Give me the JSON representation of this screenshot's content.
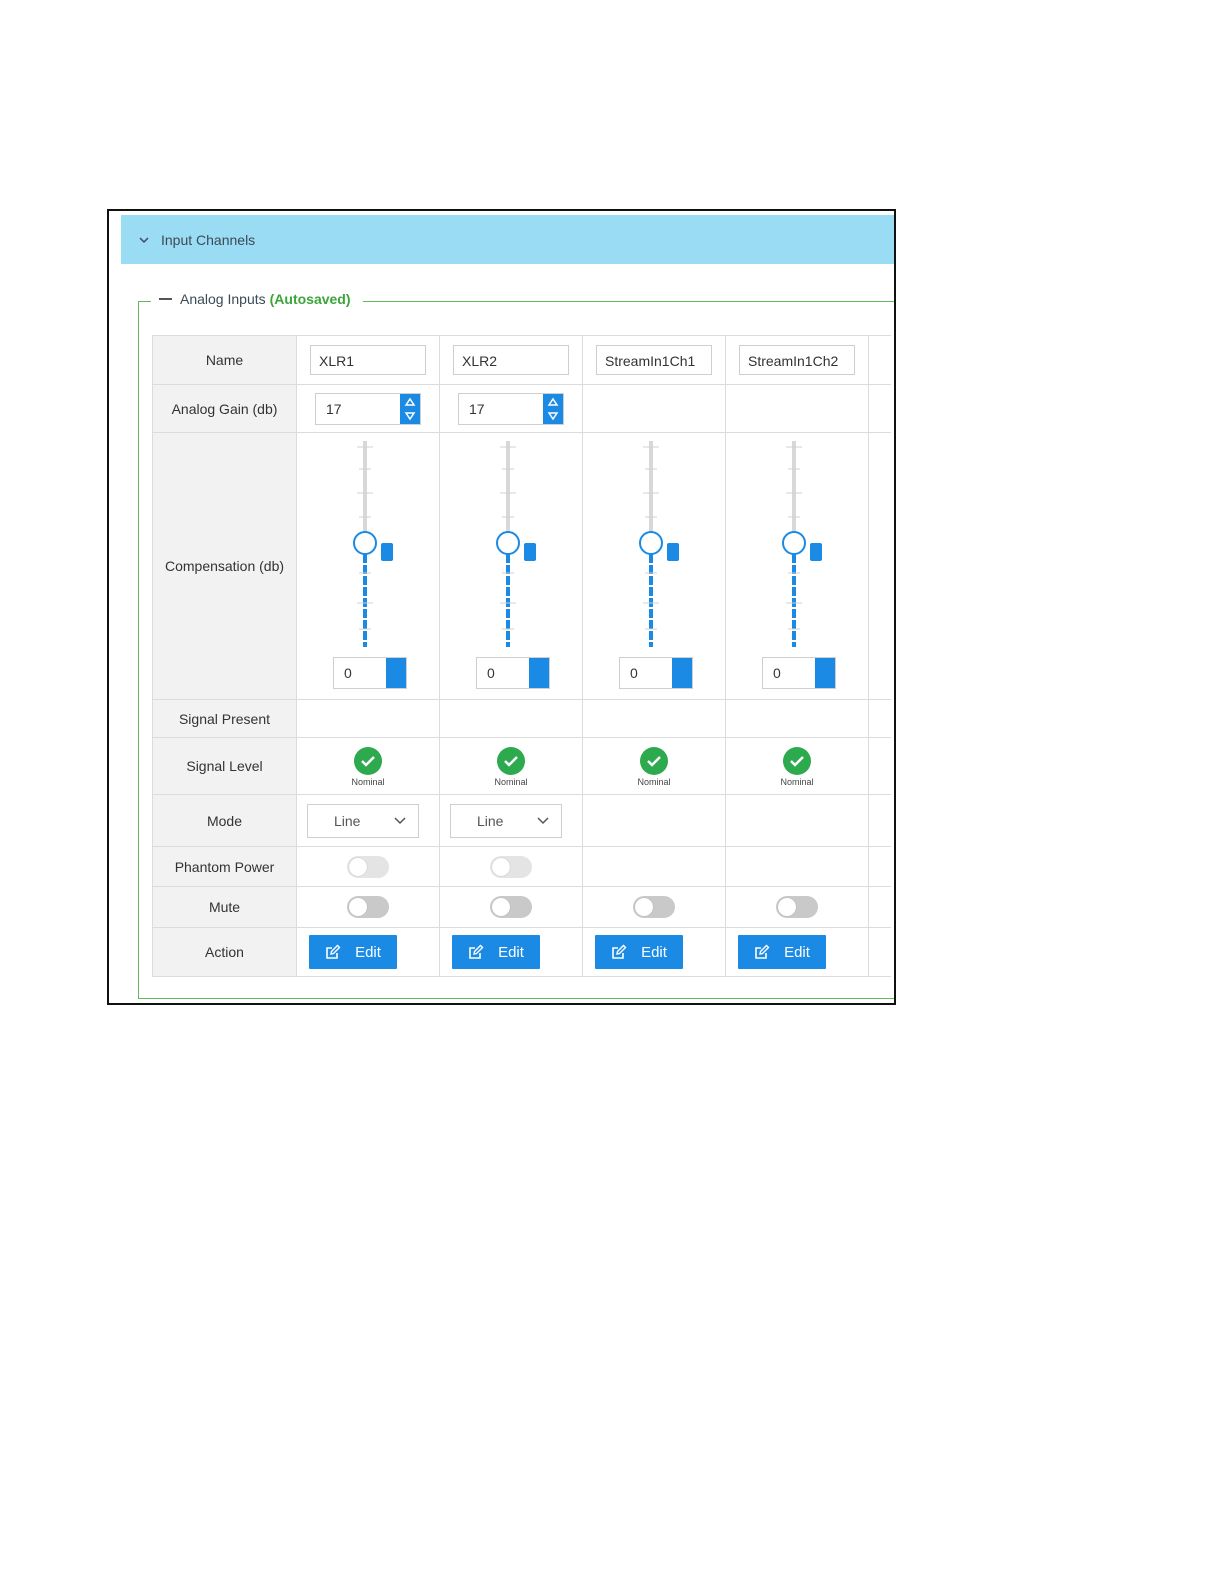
{
  "panel": {
    "title": "Input Channels"
  },
  "group": {
    "legend": "Analog Inputs",
    "status": "(Autosaved)"
  },
  "rows": {
    "name": "Name",
    "gain": "Analog Gain (db)",
    "compensation": "Compensation (db)",
    "signal_present": "Signal Present",
    "signal_level": "Signal Level",
    "mode": "Mode",
    "phantom": "Phantom Power",
    "mute": "Mute",
    "action": "Action"
  },
  "channels": [
    {
      "name": "XLR1",
      "gain": "17",
      "compensation": "0",
      "level": "Nominal",
      "mode": "Line",
      "edit": "Edit"
    },
    {
      "name": "XLR2",
      "gain": "17",
      "compensation": "0",
      "level": "Nominal",
      "mode": "Line",
      "edit": "Edit"
    },
    {
      "name": "StreamIn1Ch1",
      "compensation": "0",
      "level": "Nominal",
      "edit": "Edit"
    },
    {
      "name": "StreamIn1Ch2",
      "compensation": "0",
      "level": "Nominal",
      "edit": "Edit"
    }
  ],
  "colors": {
    "header": "#9bdcf5",
    "accent": "#1a8ae5",
    "ok": "#2eaa4e",
    "autosaved": "#3aa53a"
  }
}
